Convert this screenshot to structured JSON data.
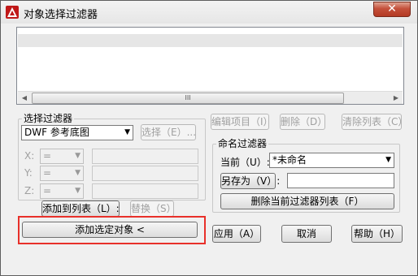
{
  "window": {
    "title": "对象选择过滤器",
    "close_symbol": "✕"
  },
  "list": {
    "scroll_thumb_label": "III",
    "left_arrow": "◀",
    "right_arrow": "▶"
  },
  "select_filter": {
    "group_label": "选择过滤器",
    "type_value": "DWF 参考底图",
    "select_button": "选择（E）...",
    "x_label": "X:",
    "y_label": "Y:",
    "z_label": "Z:",
    "operator_value": "=",
    "add_to_list_button": "添加到列表（L）:",
    "replace_button": "替换（S）",
    "add_selected_button": "添加选定对象 <"
  },
  "list_actions": {
    "edit_item": "编辑项目（I）",
    "delete": "删除（D）",
    "clear_list": "清除列表（C）"
  },
  "named_filters": {
    "group_label": "命名过滤器",
    "current_label": "当前（U）:",
    "current_value": "*未命名",
    "save_as_button": "另存为（V）:",
    "save_as_value": "",
    "delete_current_button": "删除当前过滤器列表（F）"
  },
  "footer": {
    "apply": "应用（A）",
    "cancel": "取消",
    "help": "帮助（H）"
  },
  "colors": {
    "highlight": "#e8302a",
    "close_button": "#c4503a"
  }
}
